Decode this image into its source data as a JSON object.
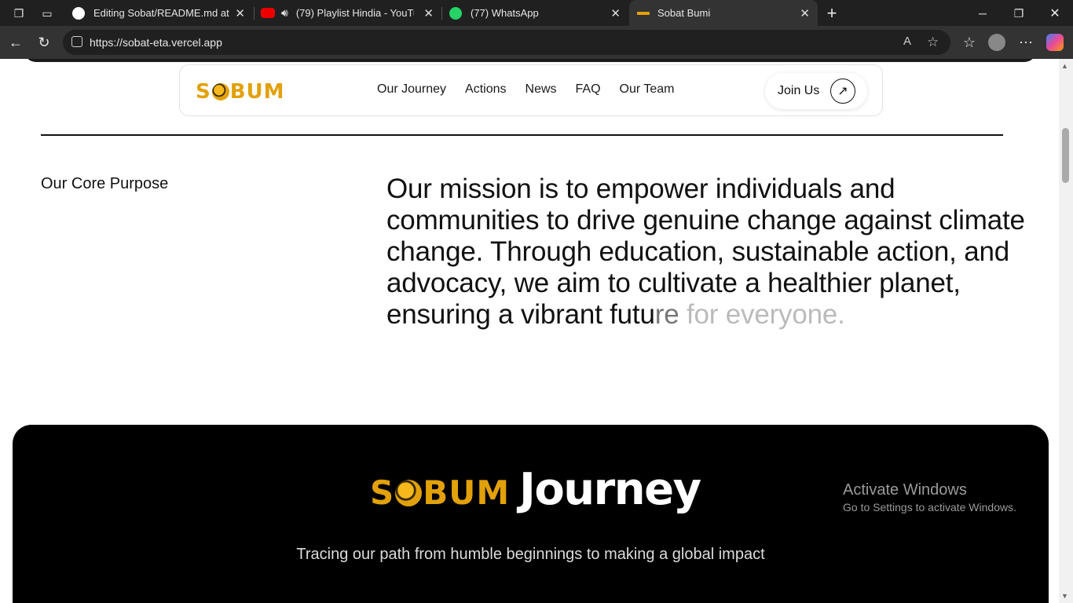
{
  "browser": {
    "tabs": [
      {
        "title": "Editing Sobat/README.md at ma",
        "icon": "github-icon"
      },
      {
        "title": "(79) Playlist Hindia - YouTube",
        "icon": "youtube-icon"
      },
      {
        "title": "(77) WhatsApp",
        "icon": "whatsapp-icon"
      },
      {
        "title": "Sobat Bumi",
        "icon": "sobum-favicon",
        "active": true
      }
    ],
    "url": "https://sobat-eta.vercel.app"
  },
  "nav": {
    "logo": "SOBUM",
    "links": [
      "Our Journey",
      "Actions",
      "News",
      "FAQ",
      "Our Team"
    ],
    "join_label": "Join Us"
  },
  "purpose": {
    "label": "Our Core Purpose",
    "mission_main": "Our mission is to empower individuals and communities to drive genuine change against climate change. Through education, sustainable action, and advocacy, we aim to cultivate a healthier planet, ensuring a vibrant futu",
    "mission_fade1": "re ",
    "mission_fade2": "for everyone."
  },
  "journey": {
    "logo": "SOBUM",
    "title": "Journey",
    "subtitle": "Tracing our path from humble beginnings to making a global impact"
  },
  "watermark": {
    "line1": "Activate Windows",
    "line2": "Go to Settings to activate Windows."
  },
  "colors": {
    "brand": "#e2a10a",
    "dark": "#000000"
  }
}
